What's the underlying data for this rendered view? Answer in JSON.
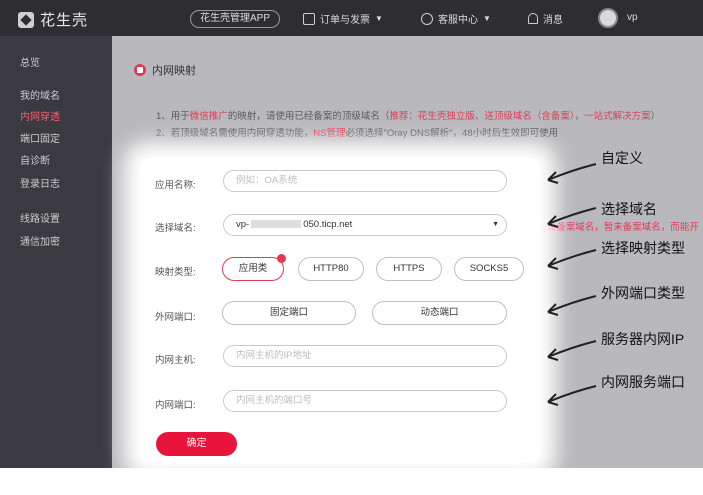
{
  "topbar": {
    "logo": "花生壳",
    "app_button": "花生壳管理APP",
    "orders": "订单与发票",
    "service": "客服中心",
    "messages": "消息",
    "user": "vp"
  },
  "sidebar": {
    "items": [
      "总览",
      "我的域名",
      "内网穿透",
      "端口固定",
      "自诊断",
      "登录日志",
      "线路设置",
      "通信加密"
    ]
  },
  "page": {
    "title": "内网映射",
    "note1_a": "1、用于",
    "note1_b": "微信推广",
    "note1_c": "的映射，请使用已经备案的顶级域名（",
    "note1_d": "推荐：花生壳独立版、送顶级域名（含备案），一站式解决方案",
    "note1_e": "）",
    "note2_a": "2、若顶级域名需使用内网穿透功能，",
    "note2_b": "NS管理",
    "note2_c": "必须选择\"Oray DNS解析\"，48小时后生效即可使用",
    "outside_hint": "HTTP需备案域名，暂未备案域名，而能开"
  },
  "form": {
    "app_name_label": "应用名称:",
    "app_name_placeholder": "例如：OA系统",
    "domain_label": "选择域名:",
    "domain_prefix": "vp-",
    "domain_suffix": "050.ticp.net",
    "mapping_label": "映射类型:",
    "mapping_types": [
      "应用类",
      "HTTP80",
      "HTTPS",
      "SOCKS5"
    ],
    "port_label": "外网端口:",
    "port_fixed": "固定端口",
    "port_dynamic": "动态端口",
    "host_label": "内网主机:",
    "host_placeholder": "内网主机的IP地址",
    "inner_port_label": "内网端口:",
    "inner_port_placeholder": "内网主机的端口号",
    "submit": "确定"
  },
  "annotations": [
    "自定义",
    "选择域名",
    "选择映射类型",
    "外网端口类型",
    "服务器内网IP",
    "内网服务端口"
  ]
}
